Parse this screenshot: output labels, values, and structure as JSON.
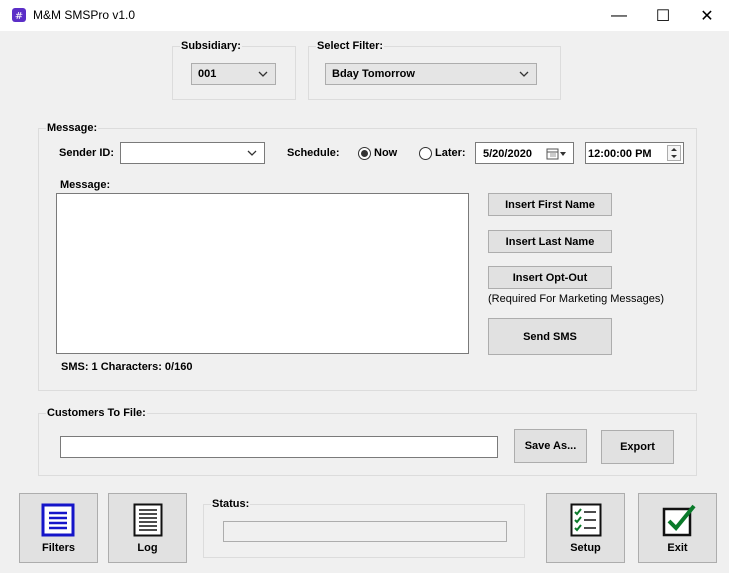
{
  "window": {
    "title": "M&M SMSPro v1.0",
    "minimize": "—",
    "maximize": "☐",
    "close": "✕"
  },
  "subsidiary": {
    "label": "Subsidiary:",
    "value": "001"
  },
  "filter": {
    "label": "Select Filter:",
    "value": "Bday Tomorrow"
  },
  "message_group": {
    "label": "Message:",
    "sender_label": "Sender ID:",
    "sender_value": "",
    "schedule_label": "Schedule:",
    "now_label": "Now",
    "later_label": "Later:",
    "date_value": "5/20/2020",
    "time_value": "12:00:00 PM",
    "message_label": "Message:",
    "message_text": "",
    "counter": "SMS: 1 Characters: 0/160",
    "insert_first": "Insert First Name",
    "insert_last": "Insert Last Name",
    "insert_optout": "Insert Opt-Out",
    "optout_note": "(Required For Marketing Messages)",
    "send": "Send SMS"
  },
  "customers_file": {
    "label": "Customers To File:",
    "value": "",
    "save_as": "Save As...",
    "export": "Export"
  },
  "bottom": {
    "filters": "Filters",
    "log": "Log",
    "status_label": "Status:",
    "status_value": "",
    "setup": "Setup",
    "exit": "Exit"
  },
  "colors": {
    "filters_icon": "#1515c9",
    "exit_check": "#0a7a2a"
  }
}
